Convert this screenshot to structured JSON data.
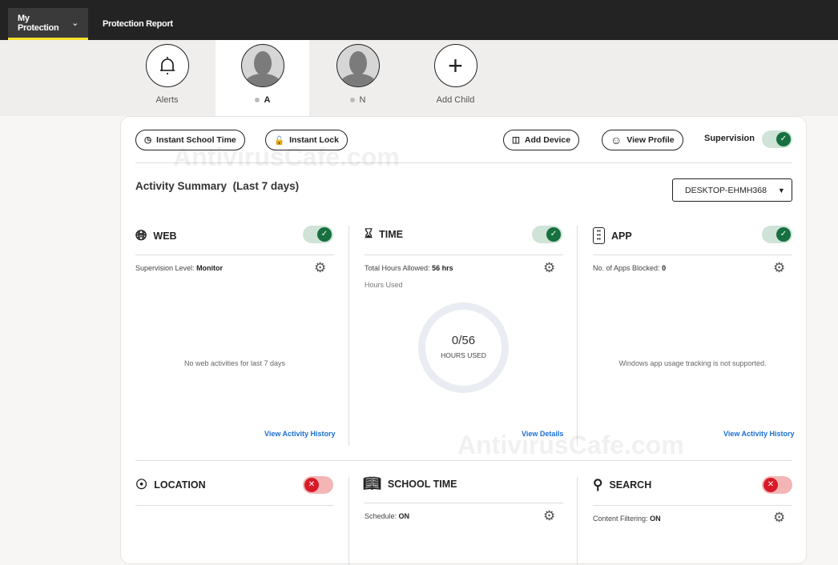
{
  "nav": {
    "my_protection": "My Protection",
    "protection_report": "Protection Report"
  },
  "profiles": [
    {
      "label": "Alerts",
      "icon": "bell-icon"
    },
    {
      "label": "A",
      "status": "offline",
      "selected": true
    },
    {
      "label": "N",
      "status": "offline"
    },
    {
      "label": "Add Child",
      "icon": "plus-icon"
    }
  ],
  "toolbar": {
    "instant_school_time": "Instant School Time",
    "instant_lock": "Instant Lock",
    "add_device": "Add Device",
    "view_profile": "View Profile",
    "supervision": "Supervision",
    "supervision_on": true
  },
  "summary": {
    "title": "Activity Summary",
    "range": "(Last 7 days)",
    "device": "DESKTOP-EHMH368"
  },
  "web": {
    "title": "WEB",
    "enabled": true,
    "level_label": "Supervision Level:",
    "level": "Monitor",
    "empty": "No web activities for last 7 days",
    "link": "View Activity History"
  },
  "time": {
    "title": "TIME",
    "enabled": true,
    "allowed_label": "Total Hours Allowed:",
    "allowed": "56 hrs",
    "used_label": "Hours Used",
    "ratio": "0/56",
    "ratio_caption": "HOURS USED",
    "used_fraction": 0,
    "link": "View Details"
  },
  "app": {
    "title": "APP",
    "enabled": true,
    "blocked_label": "No. of Apps Blocked:",
    "blocked": "0",
    "empty": "Windows app usage tracking is not supported.",
    "link": "View Activity History"
  },
  "location": {
    "title": "LOCATION",
    "enabled": false
  },
  "school_time": {
    "title": "SCHOOL TIME",
    "schedule_label": "Schedule:",
    "schedule": "ON"
  },
  "search": {
    "title": "SEARCH",
    "enabled": false,
    "filter_label": "Content Filtering:",
    "filter": "ON"
  },
  "watermark": "AntivirusCafe.com",
  "colors": {
    "accent": "#f5e12a",
    "on": "#17703f",
    "off": "#d81b28",
    "link": "#1a6fd4"
  }
}
